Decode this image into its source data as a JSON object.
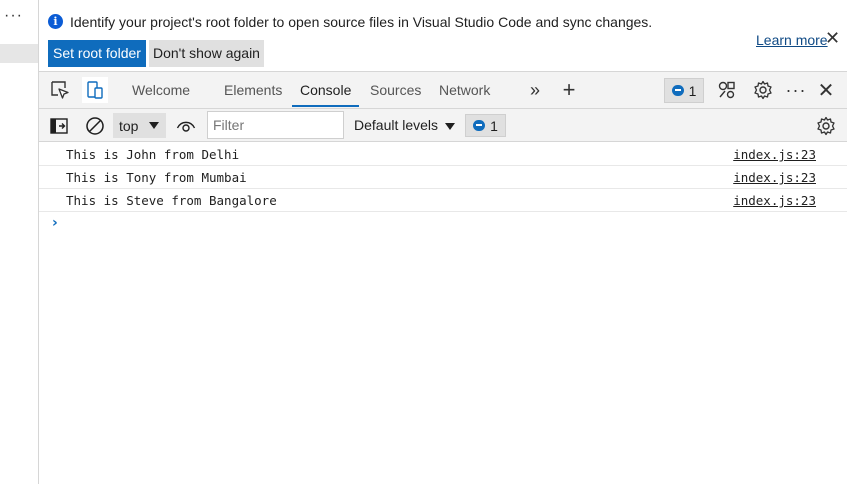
{
  "infobar": {
    "message": "Identify your project's root folder to open source files in Visual Studio Code and sync changes.",
    "set_root_label": "Set root folder",
    "dont_show_label": "Don't show again",
    "learn_more_label": "Learn more",
    "info_icon_glyph": "i",
    "close_glyph": "✕"
  },
  "tabs": [
    {
      "label": "Welcome"
    },
    {
      "label": "Elements"
    },
    {
      "label": "Console",
      "active": true
    },
    {
      "label": "Sources"
    },
    {
      "label": "Network"
    }
  ],
  "toolbar": {
    "issues_count": "1",
    "more_tabs_glyph": "»",
    "add_tab_glyph": "+",
    "menu_glyph": "···",
    "close_glyph": "✕"
  },
  "console_toolbar": {
    "context_value": "top",
    "filter_placeholder": "Filter",
    "levels_label": "Default levels",
    "message_count": "1"
  },
  "messages": [
    {
      "text": "This is John from Delhi",
      "source": "index.js:23"
    },
    {
      "text": "This is Tony from Mumbai",
      "source": "index.js:23"
    },
    {
      "text": "This is Steve from Bangalore",
      "source": "index.js:23"
    }
  ],
  "prompt_glyph": "›",
  "left_panel": {
    "menu_glyph": "···"
  },
  "colors": {
    "accent": "#0f6cbd",
    "toolbar_bg": "#f3f3f3",
    "badge_bg": "#e0e0e0"
  }
}
